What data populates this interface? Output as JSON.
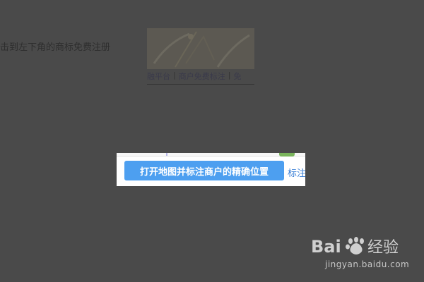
{
  "background": {
    "intro_text": "击到左下角的商标免费注册",
    "nav_items": [
      "融平台",
      "商户免费标注",
      "免"
    ]
  },
  "popup": {
    "open_map_button_label": "打开地图并标注商户的精确位置",
    "mark_link_label": "标注"
  },
  "watermark": {
    "brand": "Baidu经验",
    "url": "jingyan.baidu.com"
  },
  "colors": {
    "overlay": "#4a4a4a",
    "button": "#4d9ff0",
    "link": "#3a7fd6"
  }
}
